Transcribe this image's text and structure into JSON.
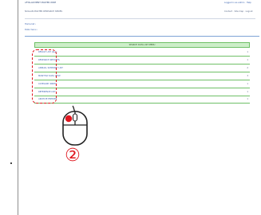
{
  "header": {
    "title": "AFTALAN MENT MASTER WIDE",
    "subtitle": "NUALAN MASTER RESEARCH SERIES",
    "right_top": "Logged in as admin · Help",
    "right_sub": "Contact · Site map · Logout"
  },
  "breadcrumb": {
    "item1": "Home list  ›",
    "item2": "Data menu  ›"
  },
  "panel": {
    "heading": "SEARCH DATA LIST MENU"
  },
  "rows": [
    {
      "label": "RESULT LIST (ALL)",
      "value": "1"
    },
    {
      "label": "RESEARCH REPORTS",
      "value": "1"
    },
    {
      "label": "ANNUAL SUMMARY LIST",
      "value": "2"
    },
    {
      "label": "MONTHLY DATA VIEW",
      "value": "3"
    },
    {
      "label": "CATEGORY INDEX",
      "value": "1"
    },
    {
      "label": "REFERENCE LIST",
      "value": "1"
    },
    {
      "label": "ARCHIVE ENTRIES",
      "value": "1"
    }
  ],
  "annotation": {
    "step": "②"
  },
  "colors": {
    "accent_red": "#e0171f",
    "green_border": "#6fc067",
    "green_fill": "#cdeec9",
    "link_blue": "#3a63b0"
  }
}
